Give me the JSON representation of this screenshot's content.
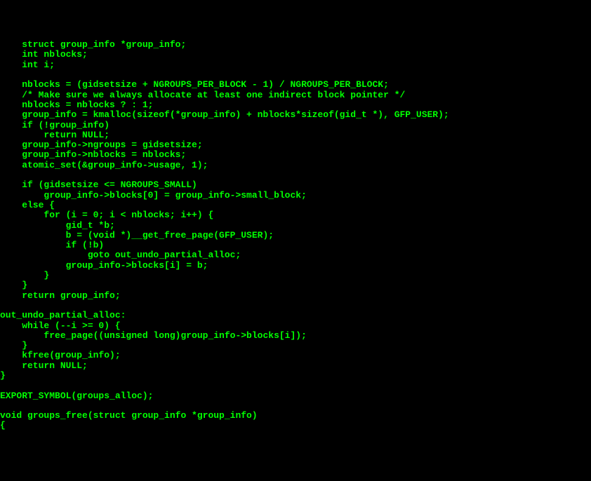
{
  "code": {
    "lines": [
      "    struct group_info *group_info;",
      "    int nblocks;",
      "    int i;",
      "",
      "    nblocks = (gidsetsize + NGROUPS_PER_BLOCK - 1) / NGROUPS_PER_BLOCK;",
      "    /* Make sure we always allocate at least one indirect block pointer */",
      "    nblocks = nblocks ? : 1;",
      "    group_info = kmalloc(sizeof(*group_info) + nblocks*sizeof(gid_t *), GFP_USER);",
      "    if (!group_info)",
      "        return NULL;",
      "    group_info->ngroups = gidsetsize;",
      "    group_info->nblocks = nblocks;",
      "    atomic_set(&group_info->usage, 1);",
      "",
      "    if (gidsetsize <= NGROUPS_SMALL)",
      "        group_info->blocks[0] = group_info->small_block;",
      "    else {",
      "        for (i = 0; i < nblocks; i++) {",
      "            gid_t *b;",
      "            b = (void *)__get_free_page(GFP_USER);",
      "            if (!b)",
      "                goto out_undo_partial_alloc;",
      "            group_info->blocks[i] = b;",
      "        }",
      "    }",
      "    return group_info;",
      "",
      "out_undo_partial_alloc:",
      "    while (--i >= 0) {",
      "        free_page((unsigned long)group_info->blocks[i]);",
      "    }",
      "    kfree(group_info);",
      "    return NULL;",
      "}",
      "",
      "EXPORT_SYMBOL(groups_alloc);",
      "",
      "void groups_free(struct group_info *group_info)",
      "{"
    ]
  }
}
